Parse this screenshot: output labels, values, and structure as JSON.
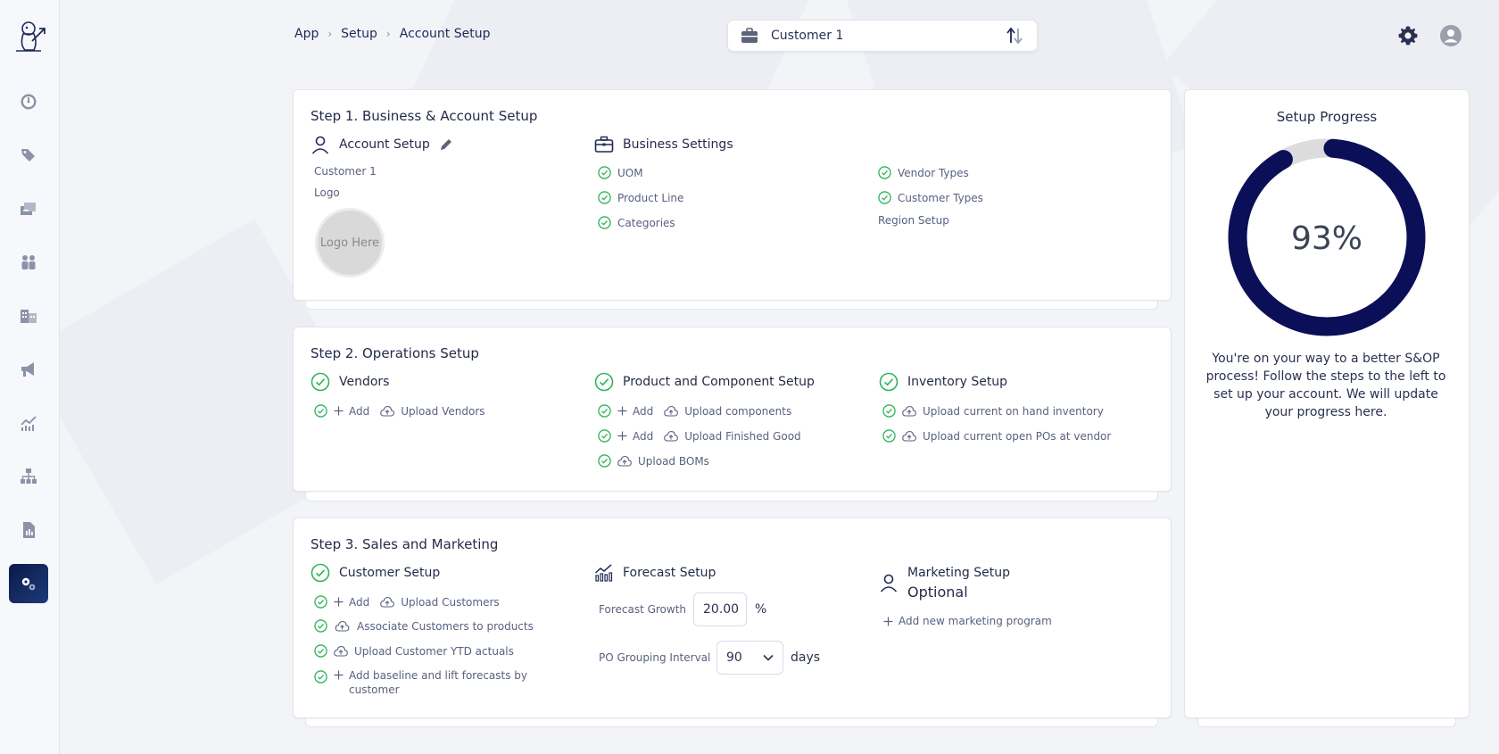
{
  "breadcrumb": [
    "App",
    "Setup",
    "Account Setup"
  ],
  "customer_select": {
    "value": "Customer 1"
  },
  "step1": {
    "title": "Step 1. Business & Account Setup",
    "account": {
      "heading": "Account Setup",
      "customer": "Customer 1",
      "logo_label": "Logo",
      "logo_placeholder": "Logo Here"
    },
    "business": {
      "heading": "Business Settings",
      "items_left": [
        "UOM",
        "Product Line",
        "Categories"
      ],
      "items_right": [
        "Vendor Types",
        "Customer Types"
      ],
      "region": "Region Setup"
    }
  },
  "step2": {
    "title": "Step 2. Operations Setup",
    "vendors": {
      "heading": "Vendors",
      "add": "Add",
      "upload": "Upload Vendors"
    },
    "product": {
      "heading": "Product and Component Setup",
      "add": "Add",
      "upload_components": "Upload components",
      "upload_finished": "Upload Finished Good",
      "upload_boms": "Upload BOMs"
    },
    "inventory": {
      "heading": "Inventory Setup",
      "upload_onhand": "Upload current on hand inventory",
      "upload_pos": "Upload current open POs at vendor"
    }
  },
  "step3": {
    "title": "Step 3. Sales and Marketing",
    "customer": {
      "heading": "Customer Setup",
      "add": "Add",
      "upload": "Upload Customers",
      "associate": "Associate Customers to products",
      "ytd": "Upload Customer YTD actuals",
      "baseline": "Add baseline and lift forecasts by customer"
    },
    "forecast": {
      "heading": "Forecast Setup",
      "growth_label": "Forecast Growth",
      "growth_value": "20.00",
      "growth_unit": "%",
      "po_label": "PO Grouping Interval",
      "po_value": "90",
      "po_unit": "days"
    },
    "marketing": {
      "heading": "Marketing Setup",
      "optional": "Optional",
      "add": "Add new marketing program"
    }
  },
  "progress": {
    "title": "Setup Progress",
    "percent": 93,
    "percent_label": "93%",
    "message": "You're on your way to a better S&OP process! Follow the steps to the left to set up your account. We will update your progress here."
  },
  "colors": {
    "navy": "#0b0f57",
    "check": "#2fb45a",
    "ring_bg": "#dcdcdc"
  }
}
